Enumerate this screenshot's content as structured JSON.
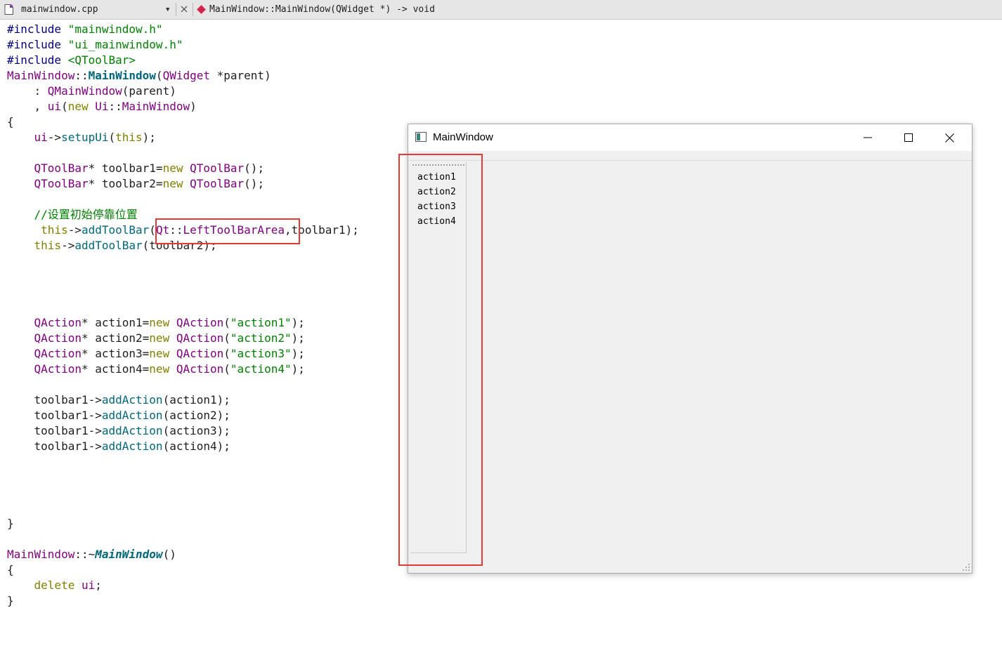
{
  "editor": {
    "file_name": "mainwindow.cpp",
    "symbol": "MainWindow::MainWindow(QWidget *) -> void",
    "icons": {
      "file": "cpp-file-icon",
      "dropdown": "chevron-down-icon",
      "close": "close-icon",
      "symbol": "symbol-diamond-icon"
    },
    "code_lines": [
      [
        [
          "pre",
          "#include "
        ],
        [
          "str",
          "\"mainwindow.h\""
        ]
      ],
      [
        [
          "pre",
          "#include "
        ],
        [
          "str",
          "\"ui_mainwindow.h\""
        ]
      ],
      [
        [
          "pre",
          "#include "
        ],
        [
          "str",
          "<QToolBar>"
        ]
      ],
      [
        [
          "type",
          "MainWindow"
        ],
        [
          "plain",
          "::"
        ],
        [
          "fnb",
          "MainWindow"
        ],
        [
          "plain",
          "("
        ],
        [
          "type",
          "QWidget"
        ],
        [
          "plain",
          " *parent)"
        ]
      ],
      [
        [
          "plain",
          "    : "
        ],
        [
          "type",
          "QMainWindow"
        ],
        [
          "plain",
          "(parent)"
        ]
      ],
      [
        [
          "plain",
          "    , "
        ],
        [
          "type",
          "ui"
        ],
        [
          "plain",
          "("
        ],
        [
          "kw",
          "new"
        ],
        [
          "plain",
          " "
        ],
        [
          "type",
          "Ui"
        ],
        [
          "plain",
          "::"
        ],
        [
          "type",
          "MainWindow"
        ],
        [
          "plain",
          ")"
        ]
      ],
      [
        [
          "plain",
          "{"
        ]
      ],
      [
        [
          "plain",
          "    "
        ],
        [
          "type",
          "ui"
        ],
        [
          "plain",
          "->"
        ],
        [
          "fn",
          "setupUi"
        ],
        [
          "plain",
          "("
        ],
        [
          "kw",
          "this"
        ],
        [
          "plain",
          ");"
        ]
      ],
      [],
      [
        [
          "plain",
          "    "
        ],
        [
          "type",
          "QToolBar"
        ],
        [
          "plain",
          "* toolbar1="
        ],
        [
          "kw",
          "new"
        ],
        [
          "plain",
          " "
        ],
        [
          "type",
          "QToolBar"
        ],
        [
          "plain",
          "();"
        ]
      ],
      [
        [
          "plain",
          "    "
        ],
        [
          "type",
          "QToolBar"
        ],
        [
          "plain",
          "* toolbar2="
        ],
        [
          "kw",
          "new"
        ],
        [
          "plain",
          " "
        ],
        [
          "type",
          "QToolBar"
        ],
        [
          "plain",
          "();"
        ]
      ],
      [],
      [
        [
          "plain",
          "    "
        ],
        [
          "com",
          "//设置初始停靠位置"
        ]
      ],
      [
        [
          "plain",
          "     "
        ],
        [
          "kw",
          "this"
        ],
        [
          "plain",
          "->"
        ],
        [
          "fn",
          "addToolBar"
        ],
        [
          "plain",
          "("
        ],
        [
          "type",
          "Qt"
        ],
        [
          "plain",
          "::"
        ],
        [
          "type",
          "LeftToolBarArea"
        ],
        [
          "plain",
          ",toolbar1);"
        ]
      ],
      [
        [
          "plain",
          "    "
        ],
        [
          "kw",
          "this"
        ],
        [
          "plain",
          "->"
        ],
        [
          "fn",
          "addToolBar"
        ],
        [
          "plain",
          "(toolbar2);"
        ]
      ],
      [],
      [],
      [],
      [],
      [
        [
          "plain",
          "    "
        ],
        [
          "type",
          "QAction"
        ],
        [
          "plain",
          "* action1="
        ],
        [
          "kw",
          "new"
        ],
        [
          "plain",
          " "
        ],
        [
          "type",
          "QAction"
        ],
        [
          "plain",
          "("
        ],
        [
          "str",
          "\"action1\""
        ],
        [
          "plain",
          ");"
        ]
      ],
      [
        [
          "plain",
          "    "
        ],
        [
          "type",
          "QAction"
        ],
        [
          "plain",
          "* action2="
        ],
        [
          "kw",
          "new"
        ],
        [
          "plain",
          " "
        ],
        [
          "type",
          "QAction"
        ],
        [
          "plain",
          "("
        ],
        [
          "str",
          "\"action2\""
        ],
        [
          "plain",
          ");"
        ]
      ],
      [
        [
          "plain",
          "    "
        ],
        [
          "type",
          "QAction"
        ],
        [
          "plain",
          "* action3="
        ],
        [
          "kw",
          "new"
        ],
        [
          "plain",
          " "
        ],
        [
          "type",
          "QAction"
        ],
        [
          "plain",
          "("
        ],
        [
          "str",
          "\"action3\""
        ],
        [
          "plain",
          ");"
        ]
      ],
      [
        [
          "plain",
          "    "
        ],
        [
          "type",
          "QAction"
        ],
        [
          "plain",
          "* action4="
        ],
        [
          "kw",
          "new"
        ],
        [
          "plain",
          " "
        ],
        [
          "type",
          "QAction"
        ],
        [
          "plain",
          "("
        ],
        [
          "str",
          "\"action4\""
        ],
        [
          "plain",
          ");"
        ]
      ],
      [],
      [
        [
          "plain",
          "    toolbar1->"
        ],
        [
          "fn",
          "addAction"
        ],
        [
          "plain",
          "(action1);"
        ]
      ],
      [
        [
          "plain",
          "    toolbar1->"
        ],
        [
          "fn",
          "addAction"
        ],
        [
          "plain",
          "(action2);"
        ]
      ],
      [
        [
          "plain",
          "    toolbar1->"
        ],
        [
          "fn",
          "addAction"
        ],
        [
          "plain",
          "(action3);"
        ]
      ],
      [
        [
          "plain",
          "    toolbar1->"
        ],
        [
          "fn",
          "addAction"
        ],
        [
          "plain",
          "(action4);"
        ]
      ],
      [],
      [],
      [],
      [],
      [
        [
          "plain",
          "}"
        ]
      ],
      [],
      [
        [
          "type",
          "MainWindow"
        ],
        [
          "plain",
          "::~"
        ],
        [
          "fni",
          "MainWindow"
        ],
        [
          "plain",
          "()"
        ]
      ],
      [
        [
          "plain",
          "{"
        ]
      ],
      [
        [
          "plain",
          "    "
        ],
        [
          "kw",
          "delete"
        ],
        [
          "plain",
          " "
        ],
        [
          "type",
          "ui"
        ],
        [
          "plain",
          ";"
        ]
      ],
      [
        [
          "plain",
          "}"
        ]
      ]
    ]
  },
  "qt_window": {
    "title": "MainWindow",
    "icons": {
      "app": "window-app-icon",
      "minimize": "minimize-icon",
      "maximize": "maximize-icon",
      "close": "close-icon",
      "size_grip": "size-grip-icon"
    },
    "toolbar_actions": [
      "action1",
      "action2",
      "action3",
      "action4"
    ]
  },
  "colors": {
    "annotation_red": "#e53935",
    "keyword": "#808000",
    "type": "#800080",
    "string": "#008000",
    "function": "#00677c",
    "preprocessor": "#000080"
  }
}
